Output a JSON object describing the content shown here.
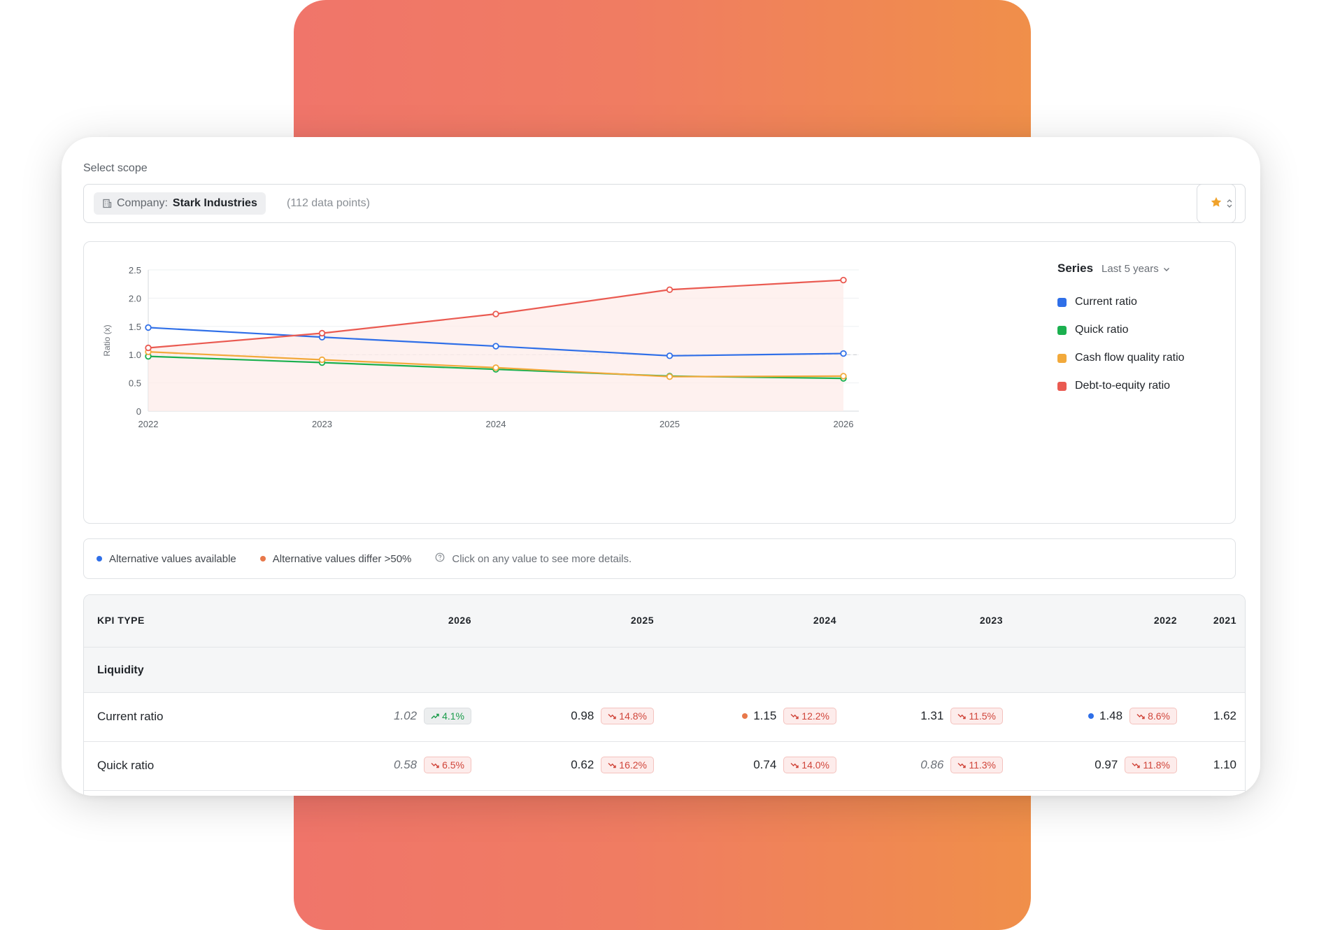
{
  "scope": {
    "label": "Select scope",
    "chip_label": "Company:",
    "chip_value": "Stark Industries",
    "data_points": "(112 data points)"
  },
  "colors": {
    "current": "#2f6fe8",
    "quick": "#1bb04f",
    "cashflow": "#f2a93b",
    "debt": "#ea5a51",
    "star": "#f0a22a"
  },
  "legend": {
    "title": "Series",
    "range": "Last 5 years",
    "items": [
      "Current ratio",
      "Quick ratio",
      "Cash flow quality ratio",
      "Debt-to-equity ratio"
    ]
  },
  "chart_data": {
    "type": "line",
    "x": [
      "2022",
      "2023",
      "2024",
      "2025",
      "2026"
    ],
    "ylabel": "Ratio (x)",
    "ylim": [
      0,
      2.5
    ],
    "yticks": [
      "0",
      "0.5",
      "1.0",
      "1.5",
      "2.0",
      "2.5"
    ],
    "reference_line": 1.0,
    "grid": true,
    "legend_position": "right",
    "series": [
      {
        "name": "Current ratio",
        "values": [
          1.48,
          1.31,
          1.15,
          0.98,
          1.02
        ]
      },
      {
        "name": "Quick ratio",
        "values": [
          0.97,
          0.86,
          0.74,
          0.62,
          0.58
        ]
      },
      {
        "name": "Cash flow quality ratio",
        "values": [
          1.05,
          0.91,
          0.77,
          0.61,
          0.62
        ]
      },
      {
        "name": "Debt-to-equity ratio",
        "values": [
          1.12,
          1.38,
          1.72,
          2.15,
          2.32
        ]
      }
    ]
  },
  "info": {
    "alt_available": "Alternative values available",
    "alt_differ": "Alternative values differ >50%",
    "hint": "Click on any value to see more details."
  },
  "table": {
    "headers": [
      "KPI TYPE",
      "2026",
      "2025",
      "2024",
      "2023",
      "2022",
      "2021"
    ],
    "group": "Liquidity",
    "rows": [
      {
        "name": "Current ratio",
        "cells": [
          {
            "value": "1.02",
            "italic": true,
            "badge": "4.1%",
            "dir": "up",
            "grey": true
          },
          {
            "value": "0.98",
            "badge": "14.8%",
            "dir": "down"
          },
          {
            "value": "1.15",
            "dot": "orange",
            "badge": "12.2%",
            "dir": "down"
          },
          {
            "value": "1.31",
            "badge": "11.5%",
            "dir": "down"
          },
          {
            "value": "1.48",
            "dot": "blue",
            "badge": "8.6%",
            "dir": "down"
          },
          {
            "value": "1.62"
          }
        ]
      },
      {
        "name": "Quick ratio",
        "cells": [
          {
            "value": "0.58",
            "italic": true,
            "badge": "6.5%",
            "dir": "down"
          },
          {
            "value": "0.62",
            "badge": "16.2%",
            "dir": "down"
          },
          {
            "value": "0.74",
            "badge": "14.0%",
            "dir": "down"
          },
          {
            "value": "0.86",
            "italic": true,
            "badge": "11.3%",
            "dir": "down"
          },
          {
            "value": "0.97",
            "badge": "11.8%",
            "dir": "down"
          },
          {
            "value": "1.10"
          }
        ]
      }
    ]
  }
}
